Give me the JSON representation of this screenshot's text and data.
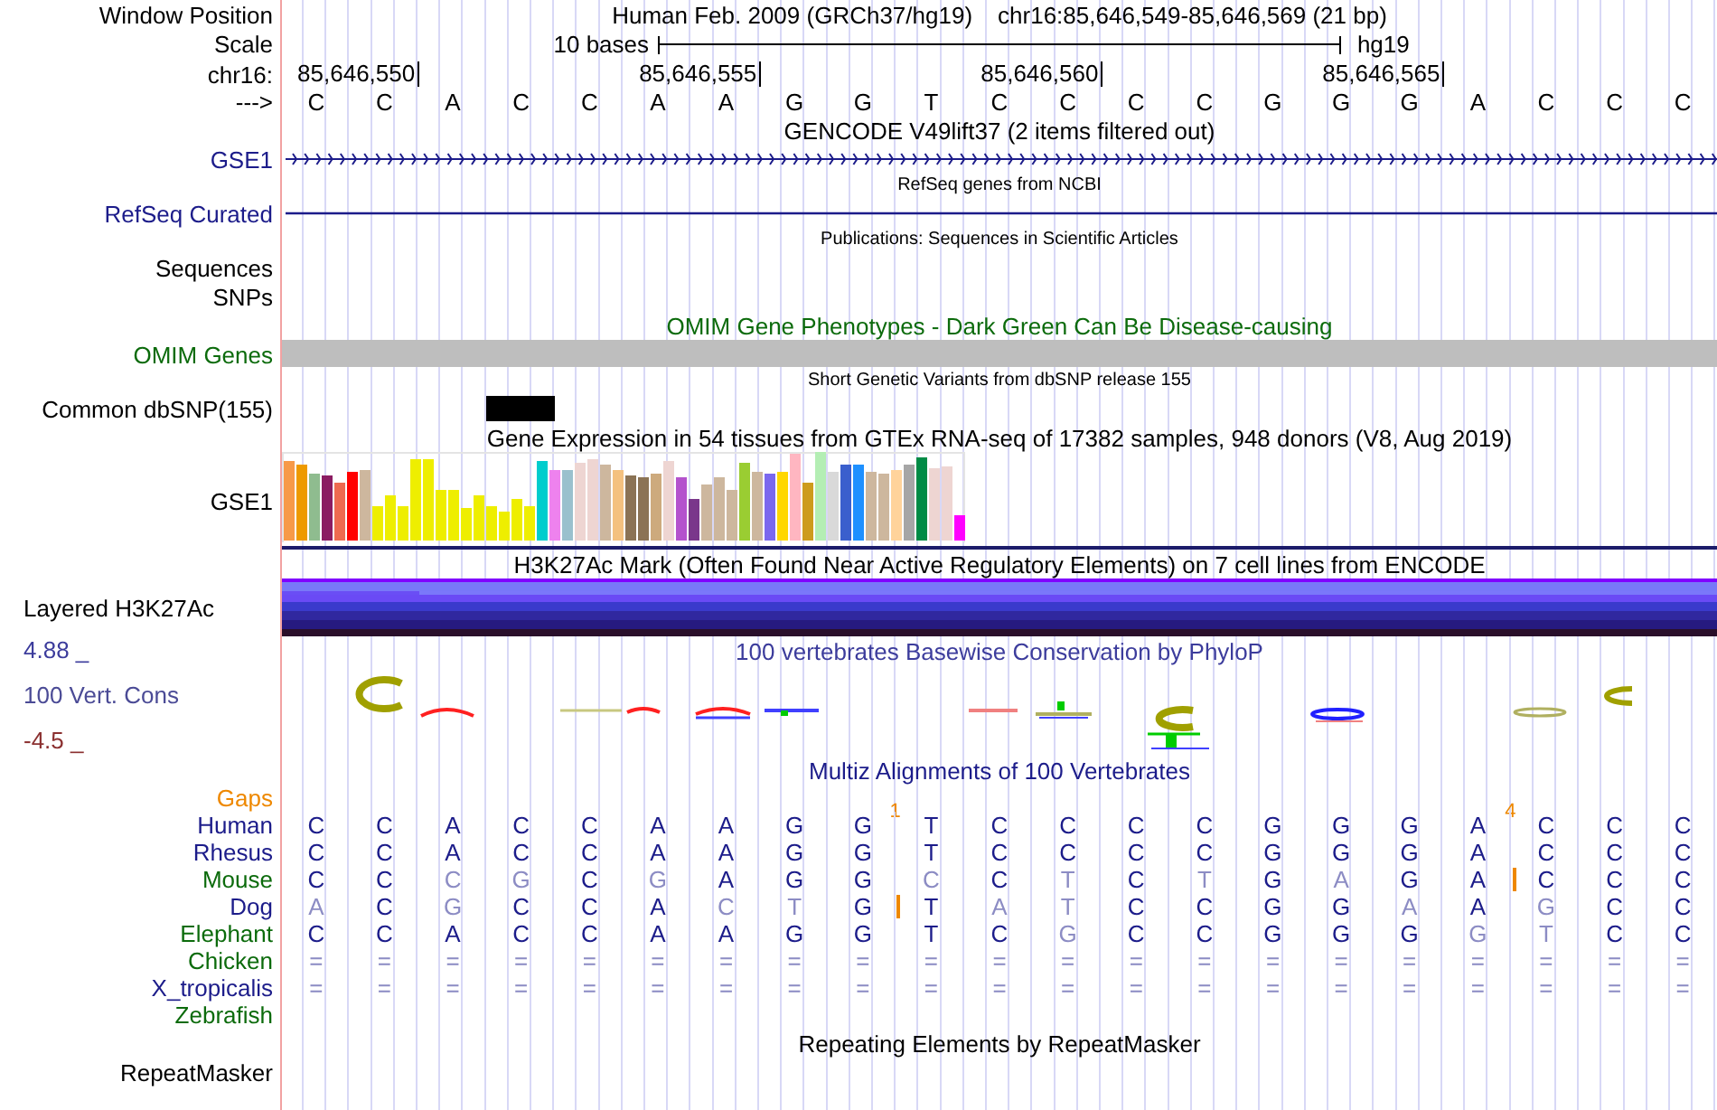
{
  "header": {
    "label": "Window Position",
    "assembly": "Human Feb. 2009 (GRCh37/hg19)",
    "position": "chr16:85,646,549-85,646,569 (21 bp)"
  },
  "scale": {
    "label": "Scale",
    "length": "10 bases",
    "assembly": "hg19"
  },
  "coordinates": {
    "label": "chr16:",
    "ticks": [
      "85,646,550",
      "85,646,555",
      "85,646,560",
      "85,646,565"
    ]
  },
  "sequence": {
    "label": "--->",
    "bases": [
      "C",
      "C",
      "A",
      "C",
      "C",
      "A",
      "A",
      "G",
      "G",
      "T",
      "C",
      "C",
      "C",
      "C",
      "G",
      "G",
      "G",
      "A",
      "C",
      "C",
      "C"
    ]
  },
  "tracks": [
    {
      "kind": "gene",
      "title": {
        "text": "GENCODE V49lift37 (2 items filtered out)"
      },
      "label": "GSE1",
      "color": "#1c1c8a",
      "arrows": true
    },
    {
      "kind": "gene",
      "caption": "RefSeq genes from NCBI",
      "label": "RefSeq Curated",
      "color": "#1c1c8a",
      "arrows": false
    },
    {
      "kind": "empty",
      "caption": "Publications: Sequences in Scientific Articles",
      "label": "Sequences"
    },
    {
      "kind": "empty",
      "label": "SNPs"
    },
    {
      "kind": "omim",
      "title": {
        "text": "OMIM Gene Phenotypes - Dark Green Can Be Disease-causing",
        "color": "#0c6b0c"
      },
      "label": "OMIM Genes",
      "color": "#0c6b0c"
    },
    {
      "kind": "snp",
      "caption": "Short Genetic Variants from dbSNP release 155",
      "label": "Common dbSNP(155)"
    },
    {
      "kind": "expression",
      "title": {
        "text": "Gene Expression in 54 tissues from GTEx RNA-seq of 17382 samples, 948 donors (V8, Aug 2019)"
      },
      "label": "GSE1"
    },
    {
      "kind": "layered",
      "title": {
        "text": "H3K27Ac Mark (Often Found Near Active Regulatory Elements) on 7 cell lines from ENCODE"
      },
      "label": "Layered H3K27Ac"
    },
    {
      "kind": "conservation",
      "title": {
        "text": "100 vertebrates Basewise Conservation by PhyloP",
        "color": "#3c3c9c"
      },
      "label": "100 Vert. Cons",
      "color": "#4b4b96",
      "max": {
        "text": "4.88 _",
        "color": "#3c3c9c"
      },
      "min": {
        "text": "-4.5 _",
        "color": "#8b3030"
      }
    },
    {
      "kind": "alignment",
      "title": {
        "text": "Multiz Alignments of 100 Vertebrates",
        "color": "#1c1c8a"
      },
      "gaps": {
        "label": "Gaps",
        "color": "#ee8800",
        "columns": [
          {},
          {},
          {},
          {},
          {},
          {},
          {},
          {},
          {},
          {
            "text": "1"
          },
          {},
          {},
          {},
          {},
          {},
          {},
          {},
          {},
          {
            "text": "4"
          },
          {},
          {}
        ]
      },
      "species": [
        {
          "name": "Human",
          "color": "#1c1c8a",
          "bases": [
            {
              "b": "C",
              "match": true,
              "insert": false
            },
            {
              "b": "C",
              "match": true,
              "insert": false
            },
            {
              "b": "A",
              "match": true,
              "insert": false
            },
            {
              "b": "C",
              "match": true,
              "insert": false
            },
            {
              "b": "C",
              "match": true,
              "insert": false
            },
            {
              "b": "A",
              "match": true,
              "insert": false
            },
            {
              "b": "A",
              "match": true,
              "insert": false
            },
            {
              "b": "G",
              "match": true,
              "insert": false
            },
            {
              "b": "G",
              "match": true,
              "insert": false
            },
            {
              "b": "T",
              "match": true,
              "insert": false
            },
            {
              "b": "C",
              "match": true,
              "insert": false
            },
            {
              "b": "C",
              "match": true,
              "insert": false
            },
            {
              "b": "C",
              "match": true,
              "insert": false
            },
            {
              "b": "C",
              "match": true,
              "insert": false
            },
            {
              "b": "G",
              "match": true,
              "insert": false
            },
            {
              "b": "G",
              "match": true,
              "insert": false
            },
            {
              "b": "G",
              "match": true,
              "insert": false
            },
            {
              "b": "A",
              "match": true,
              "insert": false
            },
            {
              "b": "C",
              "match": true,
              "insert": false
            },
            {
              "b": "C",
              "match": true,
              "insert": false
            },
            {
              "b": "C",
              "match": true,
              "insert": false
            }
          ]
        },
        {
          "name": "Rhesus",
          "color": "#1c1c8a",
          "bases": [
            {
              "b": "C",
              "match": true,
              "insert": false
            },
            {
              "b": "C",
              "match": true,
              "insert": false
            },
            {
              "b": "A",
              "match": true,
              "insert": false
            },
            {
              "b": "C",
              "match": true,
              "insert": false
            },
            {
              "b": "C",
              "match": true,
              "insert": false
            },
            {
              "b": "A",
              "match": true,
              "insert": false
            },
            {
              "b": "A",
              "match": true,
              "insert": false
            },
            {
              "b": "G",
              "match": true,
              "insert": false
            },
            {
              "b": "G",
              "match": true,
              "insert": false
            },
            {
              "b": "T",
              "match": true,
              "insert": false
            },
            {
              "b": "C",
              "match": true,
              "insert": false
            },
            {
              "b": "C",
              "match": true,
              "insert": false
            },
            {
              "b": "C",
              "match": true,
              "insert": false
            },
            {
              "b": "C",
              "match": true,
              "insert": false
            },
            {
              "b": "G",
              "match": true,
              "insert": false
            },
            {
              "b": "G",
              "match": true,
              "insert": false
            },
            {
              "b": "G",
              "match": true,
              "insert": false
            },
            {
              "b": "A",
              "match": true,
              "insert": false
            },
            {
              "b": "C",
              "match": true,
              "insert": false
            },
            {
              "b": "C",
              "match": true,
              "insert": false
            },
            {
              "b": "C",
              "match": true,
              "insert": false
            }
          ]
        },
        {
          "name": "Mouse",
          "color": "#0c6b0c",
          "bases": [
            {
              "b": "C",
              "match": true,
              "insert": false
            },
            {
              "b": "C",
              "match": true,
              "insert": false
            },
            {
              "b": "C",
              "match": false,
              "insert": false
            },
            {
              "b": "G",
              "match": false,
              "insert": false
            },
            {
              "b": "C",
              "match": true,
              "insert": false
            },
            {
              "b": "G",
              "match": false,
              "insert": false
            },
            {
              "b": "A",
              "match": true,
              "insert": false
            },
            {
              "b": "G",
              "match": true,
              "insert": false
            },
            {
              "b": "G",
              "match": true,
              "insert": false
            },
            {
              "b": "C",
              "match": false,
              "insert": false
            },
            {
              "b": "C",
              "match": true,
              "insert": false
            },
            {
              "b": "T",
              "match": false,
              "insert": false
            },
            {
              "b": "C",
              "match": true,
              "insert": false
            },
            {
              "b": "T",
              "match": false,
              "insert": false
            },
            {
              "b": "G",
              "match": true,
              "insert": false
            },
            {
              "b": "A",
              "match": false,
              "insert": false
            },
            {
              "b": "G",
              "match": true,
              "insert": false
            },
            {
              "b": "A",
              "match": true,
              "insert": false
            },
            {
              "b": "C",
              "match": true,
              "insert": true
            },
            {
              "b": "C",
              "match": true,
              "insert": false
            },
            {
              "b": "C",
              "match": true,
              "insert": false
            }
          ]
        },
        {
          "name": "Dog",
          "color": "#1c1c8a",
          "bases": [
            {
              "b": "A",
              "match": false,
              "insert": false
            },
            {
              "b": "C",
              "match": true,
              "insert": false
            },
            {
              "b": "G",
              "match": false,
              "insert": false
            },
            {
              "b": "C",
              "match": true,
              "insert": false
            },
            {
              "b": "C",
              "match": true,
              "insert": false
            },
            {
              "b": "A",
              "match": true,
              "insert": false
            },
            {
              "b": "C",
              "match": false,
              "insert": false
            },
            {
              "b": "T",
              "match": false,
              "insert": false
            },
            {
              "b": "G",
              "match": true,
              "insert": false
            },
            {
              "b": "T",
              "match": true,
              "insert": true
            },
            {
              "b": "A",
              "match": false,
              "insert": false
            },
            {
              "b": "T",
              "match": false,
              "insert": false
            },
            {
              "b": "C",
              "match": true,
              "insert": false
            },
            {
              "b": "C",
              "match": true,
              "insert": false
            },
            {
              "b": "G",
              "match": true,
              "insert": false
            },
            {
              "b": "G",
              "match": true,
              "insert": false
            },
            {
              "b": "A",
              "match": false,
              "insert": false
            },
            {
              "b": "A",
              "match": true,
              "insert": false
            },
            {
              "b": "G",
              "match": false,
              "insert": false
            },
            {
              "b": "C",
              "match": true,
              "insert": false
            },
            {
              "b": "C",
              "match": true,
              "insert": false
            }
          ]
        },
        {
          "name": "Elephant",
          "color": "#0c6b0c",
          "bases": [
            {
              "b": "C",
              "match": true,
              "insert": false
            },
            {
              "b": "C",
              "match": true,
              "insert": false
            },
            {
              "b": "A",
              "match": true,
              "insert": false
            },
            {
              "b": "C",
              "match": true,
              "insert": false
            },
            {
              "b": "C",
              "match": true,
              "insert": false
            },
            {
              "b": "A",
              "match": true,
              "insert": false
            },
            {
              "b": "A",
              "match": true,
              "insert": false
            },
            {
              "b": "G",
              "match": true,
              "insert": false
            },
            {
              "b": "G",
              "match": true,
              "insert": false
            },
            {
              "b": "T",
              "match": true,
              "insert": false
            },
            {
              "b": "C",
              "match": true,
              "insert": false
            },
            {
              "b": "G",
              "match": false,
              "insert": false
            },
            {
              "b": "C",
              "match": true,
              "insert": false
            },
            {
              "b": "C",
              "match": true,
              "insert": false
            },
            {
              "b": "G",
              "match": true,
              "insert": false
            },
            {
              "b": "G",
              "match": true,
              "insert": false
            },
            {
              "b": "G",
              "match": true,
              "insert": false
            },
            {
              "b": "G",
              "match": false,
              "insert": false
            },
            {
              "b": "T",
              "match": false,
              "insert": false
            },
            {
              "b": "C",
              "match": true,
              "insert": false
            },
            {
              "b": "C",
              "match": true,
              "insert": false
            }
          ]
        },
        {
          "name": "Chicken",
          "color": "#0c6b0c",
          "bases": [
            {
              "b": "=",
              "match": false,
              "insert": false
            },
            {
              "b": "=",
              "match": false,
              "insert": false
            },
            {
              "b": "=",
              "match": false,
              "insert": false
            },
            {
              "b": "=",
              "match": false,
              "insert": false
            },
            {
              "b": "=",
              "match": false,
              "insert": false
            },
            {
              "b": "=",
              "match": false,
              "insert": false
            },
            {
              "b": "=",
              "match": false,
              "insert": false
            },
            {
              "b": "=",
              "match": false,
              "insert": false
            },
            {
              "b": "=",
              "match": false,
              "insert": false
            },
            {
              "b": "=",
              "match": false,
              "insert": false
            },
            {
              "b": "=",
              "match": false,
              "insert": false
            },
            {
              "b": "=",
              "match": false,
              "insert": false
            },
            {
              "b": "=",
              "match": false,
              "insert": false
            },
            {
              "b": "=",
              "match": false,
              "insert": false
            },
            {
              "b": "=",
              "match": false,
              "insert": false
            },
            {
              "b": "=",
              "match": false,
              "insert": false
            },
            {
              "b": "=",
              "match": false,
              "insert": false
            },
            {
              "b": "=",
              "match": false,
              "insert": false
            },
            {
              "b": "=",
              "match": false,
              "insert": false
            },
            {
              "b": "=",
              "match": false,
              "insert": false
            },
            {
              "b": "=",
              "match": false,
              "insert": false
            }
          ]
        },
        {
          "name": "X_tropicalis",
          "color": "#1c1c8a",
          "bases": [
            {
              "b": "=",
              "match": false,
              "insert": false
            },
            {
              "b": "=",
              "match": false,
              "insert": false
            },
            {
              "b": "=",
              "match": false,
              "insert": false
            },
            {
              "b": "=",
              "match": false,
              "insert": false
            },
            {
              "b": "=",
              "match": false,
              "insert": false
            },
            {
              "b": "=",
              "match": false,
              "insert": false
            },
            {
              "b": "=",
              "match": false,
              "insert": false
            },
            {
              "b": "=",
              "match": false,
              "insert": false
            },
            {
              "b": "=",
              "match": false,
              "insert": false
            },
            {
              "b": "=",
              "match": false,
              "insert": false
            },
            {
              "b": "=",
              "match": false,
              "insert": false
            },
            {
              "b": "=",
              "match": false,
              "insert": false
            },
            {
              "b": "=",
              "match": false,
              "insert": false
            },
            {
              "b": "=",
              "match": false,
              "insert": false
            },
            {
              "b": "=",
              "match": false,
              "insert": false
            },
            {
              "b": "=",
              "match": false,
              "insert": false
            },
            {
              "b": "=",
              "match": false,
              "insert": false
            },
            {
              "b": "=",
              "match": false,
              "insert": false
            },
            {
              "b": "=",
              "match": false,
              "insert": false
            },
            {
              "b": "=",
              "match": false,
              "insert": false
            },
            {
              "b": "=",
              "match": false,
              "insert": false
            }
          ]
        },
        {
          "name": "Zebrafish",
          "color": "#0c6b0c"
        }
      ]
    },
    {
      "kind": "empty",
      "title": {
        "text": "Repeating Elements by RepeatMasker"
      },
      "label": "RepeatMasker"
    }
  ]
}
